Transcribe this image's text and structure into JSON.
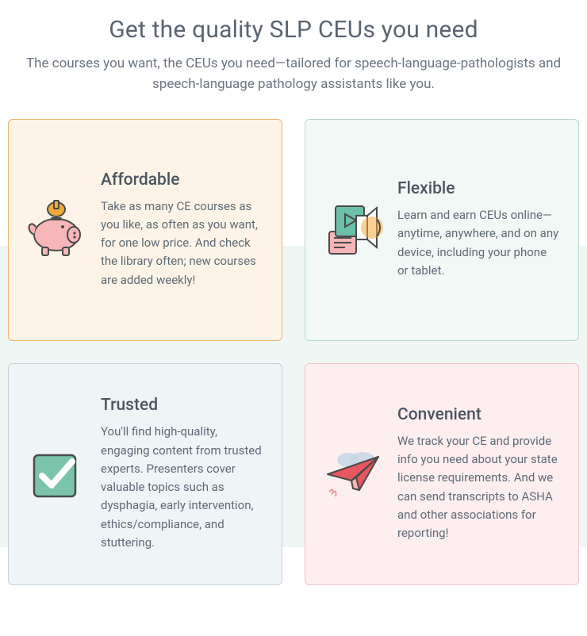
{
  "header": {
    "title": "Get the quality SLP CEUs you need",
    "subtitle": "The courses you want, the CEUs you need—tailored for speech-language-pathologists and speech-language pathology assistants like you."
  },
  "cards": [
    {
      "title": "Affordable",
      "desc": "Take as many CE courses as you like, as often as you want, for one low price. And check the library often; new courses are added weekly!",
      "accent": "#efb26a",
      "bg": "#fdf4e7",
      "icon": "piggy-bank-icon"
    },
    {
      "title": "Flexible",
      "desc": "Learn and earn CEUs online—anytime, anywhere, and on any device, including your phone or tablet.",
      "accent": "#b8d9cc",
      "bg": "#f1f8f5",
      "icon": "media-player-icon"
    },
    {
      "title": "Trusted",
      "desc": "You'll find high-quality, engaging content from trusted experts. Presenters cover valuable topics such as dysphagia, early intervention, ethics/compliance, and stuttering.",
      "accent": "#c3d3d9",
      "bg": "#eff4f6",
      "icon": "checkmark-icon"
    },
    {
      "title": "Convenient",
      "desc": "We track your CE and provide info you need about your state license requirements. And we can send transcripts to ASHA and other associations for reporting!",
      "accent": "#f1c4c9",
      "bg": "#fdeef0",
      "icon": "paper-plane-icon"
    }
  ]
}
